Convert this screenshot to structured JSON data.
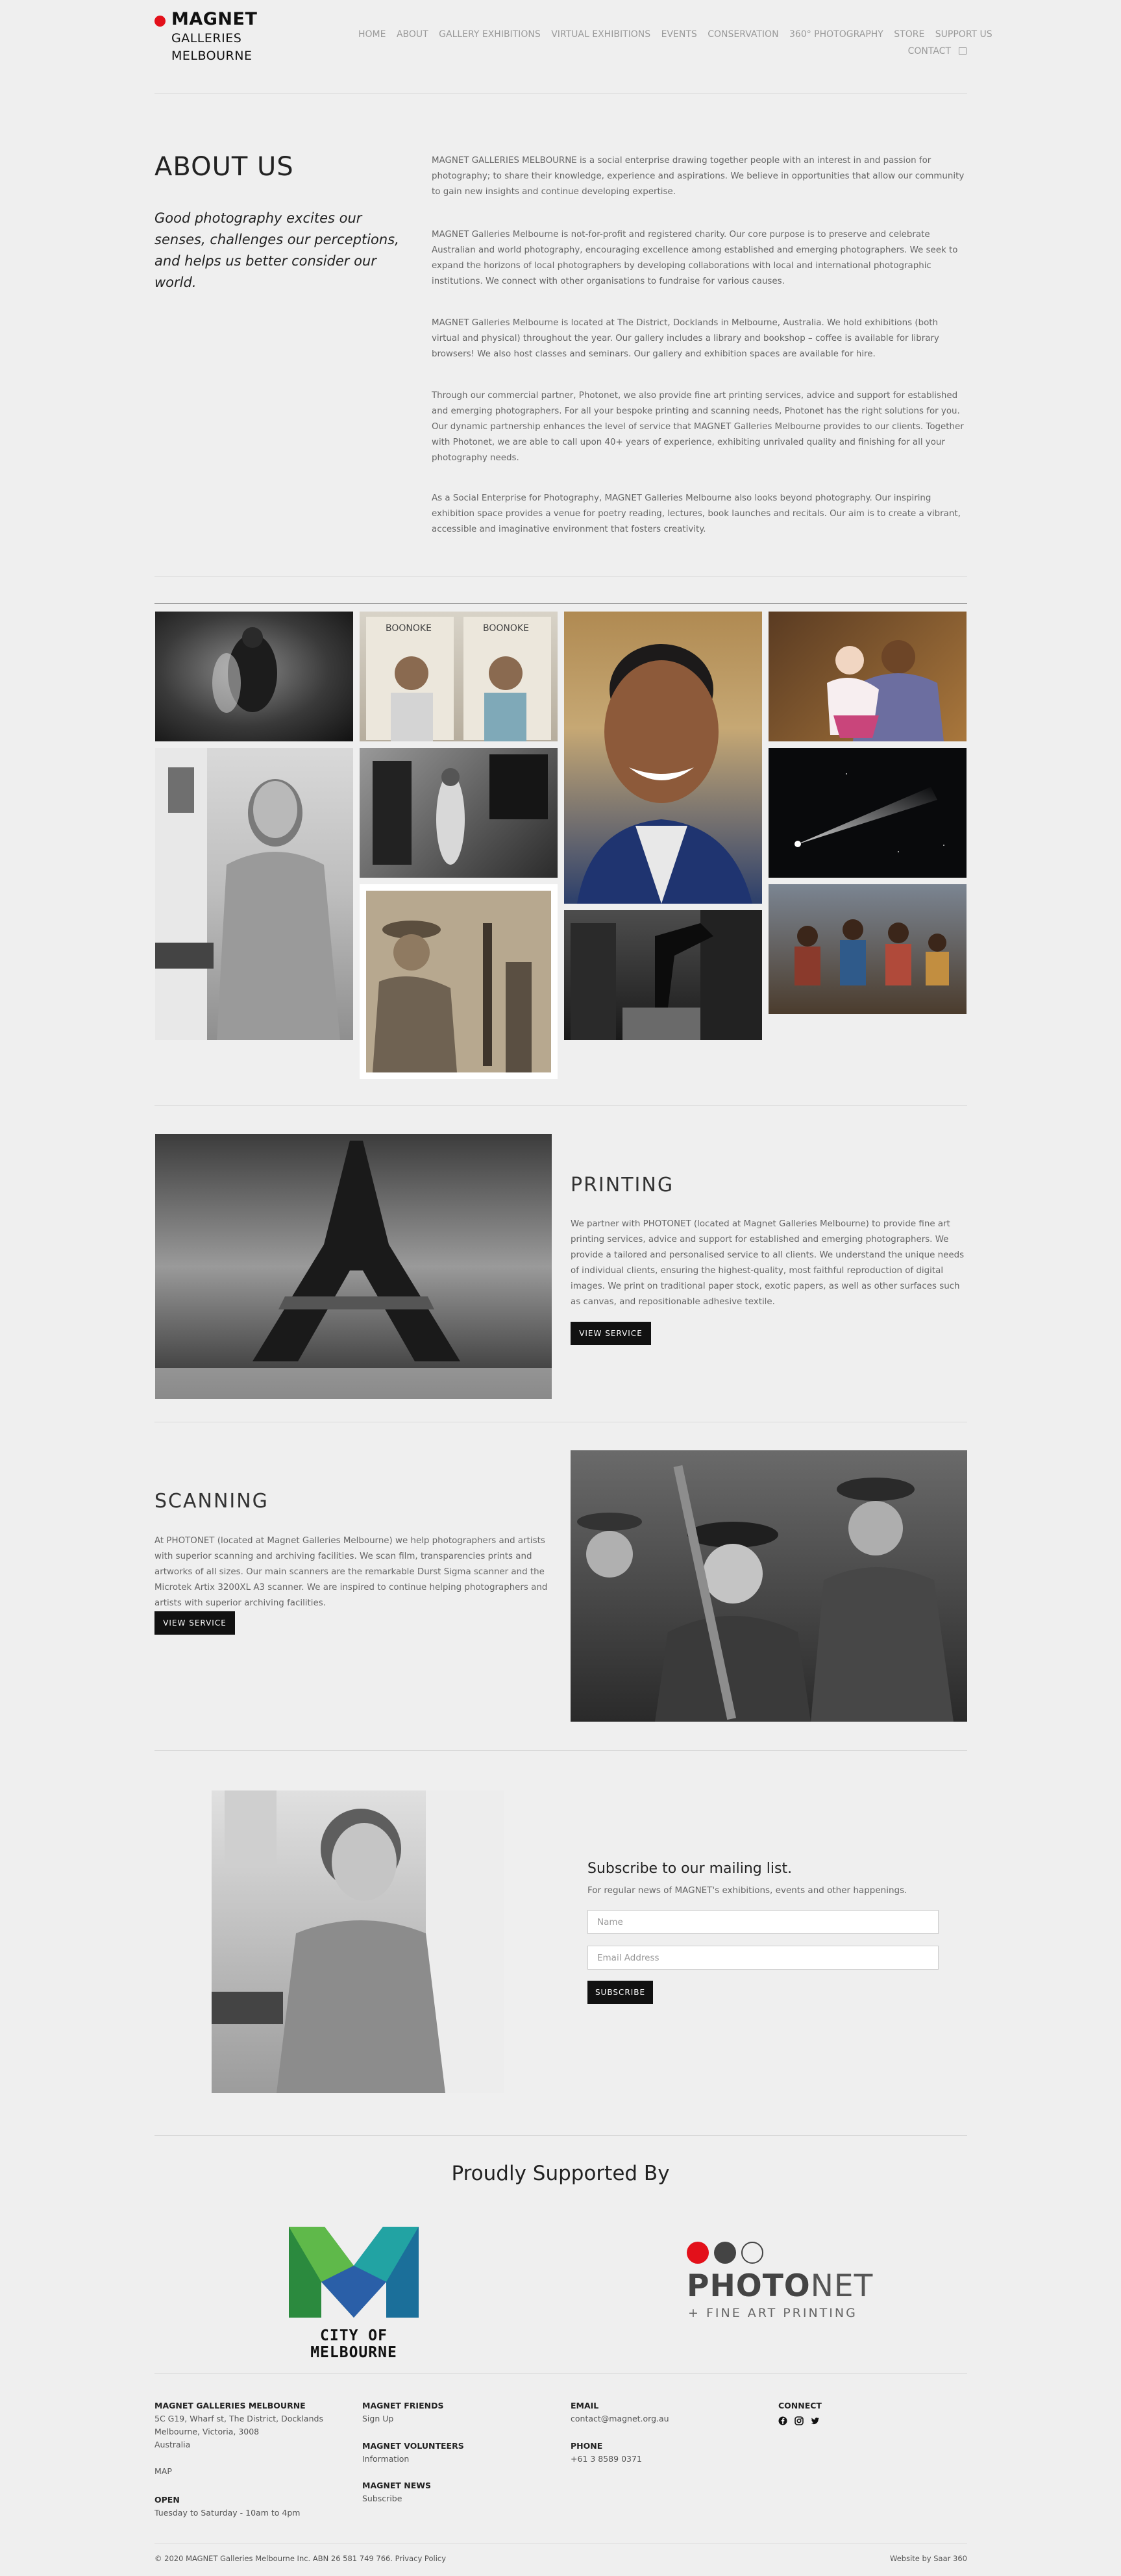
{
  "header": {
    "logo_line1": "MAGNET",
    "logo_line2": "GALLERIES",
    "logo_line3": "MELBOURNE",
    "nav": [
      "HOME",
      "ABOUT",
      "GALLERY EXHIBITIONS",
      "VIRTUAL EXHIBITIONS",
      "EVENTS",
      "CONSERVATION",
      "360° PHOTOGRAPHY",
      "STORE",
      "SUPPORT US"
    ],
    "nav_row2": "CONTACT"
  },
  "about": {
    "title": "ABOUT US",
    "tagline": "Good photography excites our senses, challenges our perceptions, and helps us better consider our world.",
    "paragraphs": [
      "MAGNET GALLERIES MELBOURNE is a social enterprise drawing together people with an interest in and passion for photography; to share their knowledge, experience and aspirations. We believe in opportunities that allow our community to gain new insights and continue developing expertise.",
      "MAGNET Galleries Melbourne is not-for-profit and registered charity. Our core purpose is to preserve and celebrate Australian and world photography, encouraging excellence among established and emerging photographers. We seek to expand the horizons of local photographers by developing collaborations with local and international photographic institutions. We connect with other organisations to fundraise for various causes.",
      "MAGNET Galleries Melbourne is located at The District, Docklands in Melbourne, Australia. We hold exhibitions (both virtual and physical) throughout the year. Our gallery includes a library and bookshop – coffee is available for library browsers! We also host classes and seminars. Our gallery and exhibition spaces are available for hire.",
      "Through our commercial partner, Photonet, we also provide fine art printing services, advice and support for established and emerging photographers. For all your bespoke printing and scanning needs, Photonet has the right solutions for you. Our dynamic partnership enhances the level of service that MAGNET Galleries Melbourne provides to our clients. Together with Photonet, we are able to call upon 40+ years of experience, exhibiting unrivaled quality and finishing for all your photography needs.",
      "As a Social Enterprise for Photography, MAGNET Galleries Melbourne also looks beyond photography. Our inspiring exhibition space provides a venue for poetry reading, lectures, book launches and recitals. Our aim is to create a vibrant, accessible and imaginative environment that fosters creativity."
    ]
  },
  "printing": {
    "title": "PRINTING",
    "text": "We partner with PHOTONET (located at Magnet Galleries Melbourne) to provide fine art printing services, advice and support for established and emerging photographers. We provide a tailored and personalised service to all clients. We understand the unique needs of individual clients, ensuring the highest-quality, most faithful reproduction of digital images. We print on traditional paper stock, exotic papers, as well as other surfaces such as canvas, and repositionable adhesive textile.",
    "button": "VIEW SERVICE"
  },
  "scanning": {
    "title": "SCANNING",
    "text": "At PHOTONET (located at Magnet Galleries Melbourne) we help photographers and artists with superior scanning and archiving facilities. We scan film, transparencies prints and artworks of all sizes. Our main scanners are the remarkable Durst Sigma scanner and the Microtek Artix 3200XL A3 scanner. We are inspired to continue helping photographers and artists with superior archiving facilities.",
    "button": "VIEW SERVICE"
  },
  "subscribe": {
    "title": "Subscribe to our mailing list.",
    "text": "For regular news of MAGNET's exhibitions, events and other happenings.",
    "name_placeholder": "Name",
    "email_placeholder": "Email Address",
    "button": "SUBSCRIBE"
  },
  "sponsors": {
    "title": "Proudly Supported By",
    "com_label": "CITY OF MELBOURNE",
    "photonet_bold": "PHOTO",
    "photonet_rest": "NET",
    "photonet_sub": "+ FINE ART PRINTING"
  },
  "footer": {
    "col1_title": "MAGNET GALLERIES MELBOURNE",
    "col1_addr1": "5C G19, Wharf st, The District, Docklands",
    "col1_addr2": "Melbourne, Victoria, 3008",
    "col1_addr3": "Australia",
    "col1_map": "MAP",
    "col1_open_title": "OPEN",
    "col1_open": "Tuesday to Saturday - 10am to 4pm",
    "col2_friends_title": "MAGNET FRIENDS",
    "col2_friends": "Sign Up",
    "col2_vol_title": "MAGNET VOLUNTEERS",
    "col2_vol": "Information",
    "col2_news_title": "MAGNET NEWS",
    "col2_news": "Subscribe",
    "col3_email_title": "EMAIL",
    "col3_email": "contact@magnet.org.au",
    "col3_phone_title": "PHONE",
    "col3_phone": "+61 3 8589 0371",
    "col4_title": "CONNECT",
    "copyright": "© 2020 MAGNET Galleries Melbourne Inc. ABN 26 581 749 766. Privacy Policy",
    "credit": "Website by Saar 360"
  },
  "colors": {
    "logo_red": "#e3101a",
    "background": "#efefef",
    "button": "#111111"
  },
  "icons": [
    "facebook-icon",
    "instagram-icon",
    "twitter-icon",
    "cart-icon"
  ]
}
